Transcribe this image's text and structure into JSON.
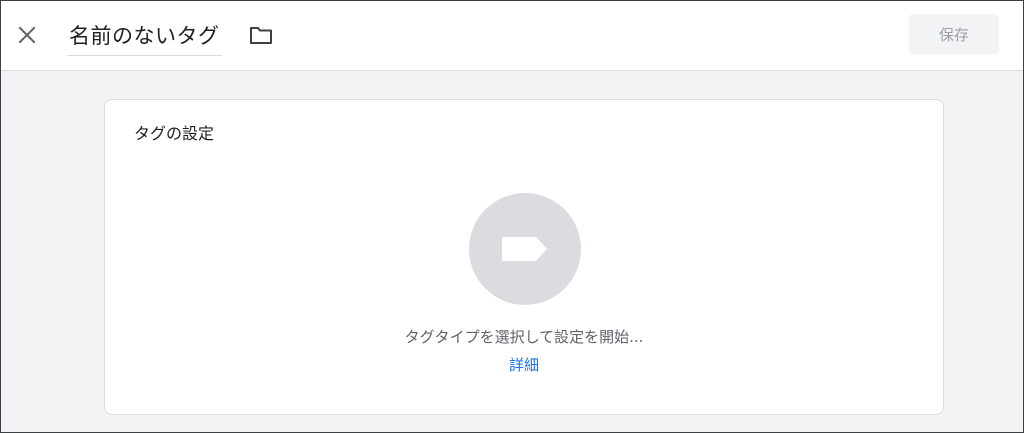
{
  "header": {
    "close_icon": "close-icon",
    "title": "名前のないタグ",
    "folder_icon": "folder-icon",
    "save_label": "保存"
  },
  "card": {
    "title": "タグの設定",
    "tag_icon": "tag-icon",
    "prompt": "タグタイプを選択して設定を開始...",
    "details_link": "詳細"
  },
  "colors": {
    "background": "#f1f3f4",
    "card": "#ffffff",
    "circle": "#dadce0",
    "link": "#1a73e8",
    "muted_text": "#5f6368",
    "disabled_text": "#9aa0a6"
  }
}
